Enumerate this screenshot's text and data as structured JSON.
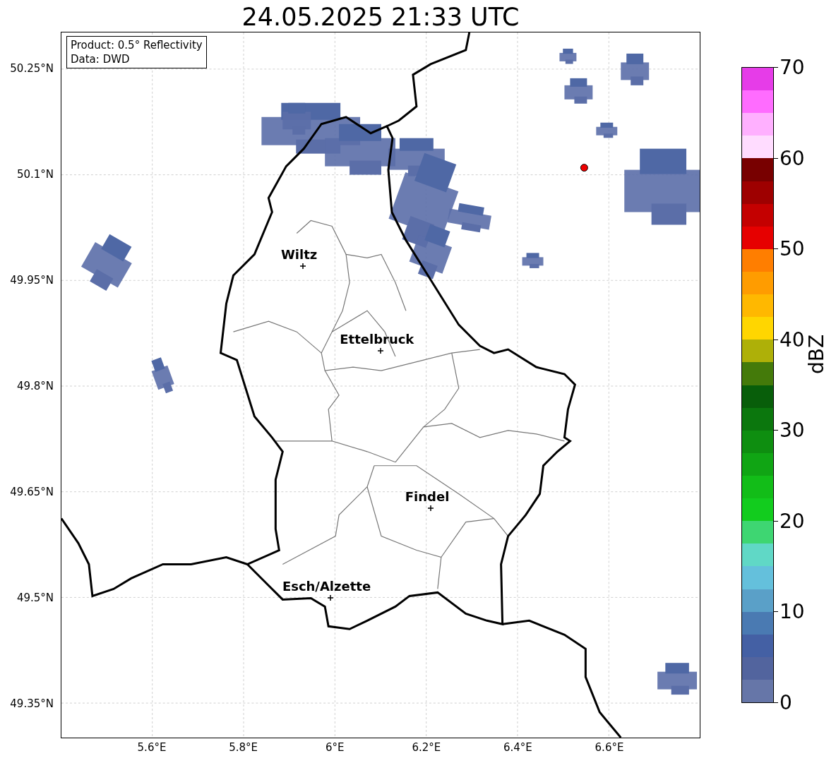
{
  "title": "24.05.2025 21:33 UTC",
  "info_box": [
    "Product: 0.5° Reflectivity",
    "Data: DWD"
  ],
  "lat_ticks": [
    "50.25°N",
    "50.1°N",
    "49.95°N",
    "49.8°N",
    "49.65°N",
    "49.5°N",
    "49.35°N"
  ],
  "lon_ticks": [
    "5.6°E",
    "5.8°E",
    "6°E",
    "6.2°E",
    "6.4°E",
    "6.6°E"
  ],
  "cities": [
    {
      "name": "Wiltz"
    },
    {
      "name": "Ettelbruck"
    },
    {
      "name": "Findel"
    },
    {
      "name": "Esch/Alzette"
    }
  ],
  "colorbar": {
    "label": "dBZ",
    "ticks": [
      "70",
      "60",
      "50",
      "40",
      "30",
      "20",
      "10",
      "0"
    ],
    "bins": [
      {
        "color": "#e63ce8"
      },
      {
        "color": "#ff6cff"
      },
      {
        "color": "#ffb0ff"
      },
      {
        "color": "#ffdcff"
      },
      {
        "color": "#780000"
      },
      {
        "color": "#9e0000"
      },
      {
        "color": "#c40000"
      },
      {
        "color": "#e60000"
      },
      {
        "color": "#ff7e00"
      },
      {
        "color": "#ff9c00"
      },
      {
        "color": "#ffb800"
      },
      {
        "color": "#ffd600"
      },
      {
        "color": "#aeb008"
      },
      {
        "color": "#447a0a"
      },
      {
        "color": "#085e0a"
      },
      {
        "color": "#0b770d"
      },
      {
        "color": "#0e8e10"
      },
      {
        "color": "#10a514"
      },
      {
        "color": "#12bd18"
      },
      {
        "color": "#12cc1e"
      },
      {
        "color": "#3ed672"
      },
      {
        "color": "#60d8c6"
      },
      {
        "color": "#64c0dc"
      },
      {
        "color": "#5aa0c8"
      },
      {
        "color": "#4a7ab2"
      },
      {
        "color": "#4460a4"
      },
      {
        "color": "#52649e"
      },
      {
        "color": "#6676a8"
      }
    ]
  }
}
